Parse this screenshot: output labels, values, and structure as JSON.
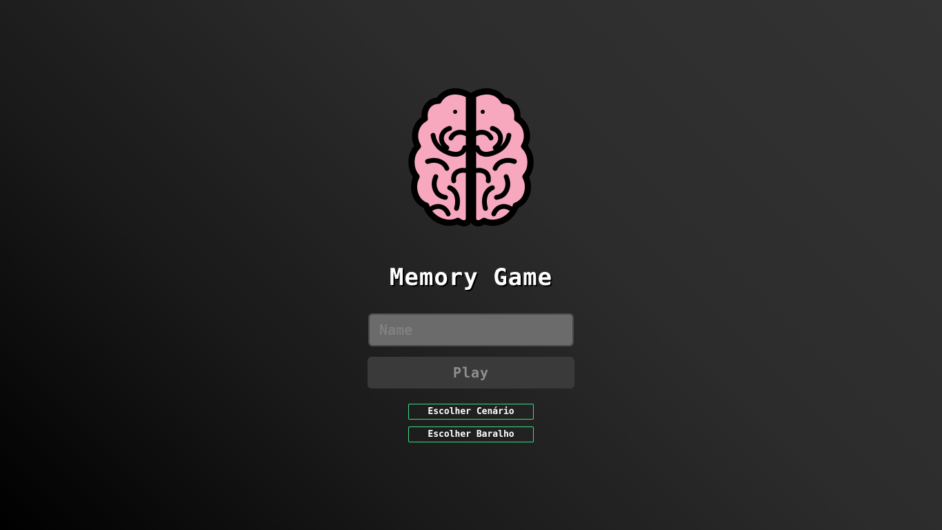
{
  "app": {
    "title": "Memory Game",
    "logo_icon": "brain-icon"
  },
  "form": {
    "name_placeholder": "Name",
    "name_value": "",
    "play_label": "Play"
  },
  "options": {
    "choose_scene_label": "Escolher Cenário",
    "choose_deck_label": "Escolher Baralho"
  },
  "colors": {
    "brain_fill": "#f7a8bf",
    "brain_outline": "#000000",
    "option_border": "#3ddc84",
    "input_bg": "#6b6b6b",
    "button_bg": "#3a3a3a"
  }
}
